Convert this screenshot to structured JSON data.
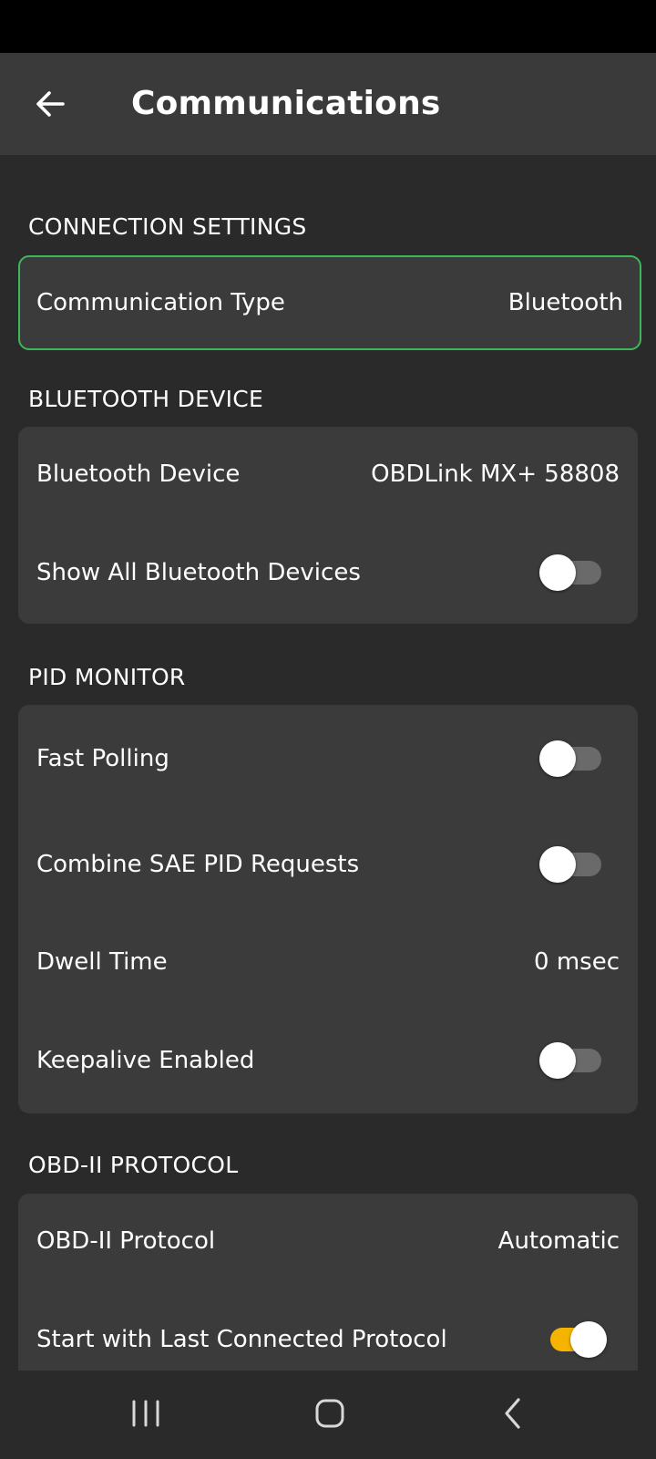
{
  "app_bar": {
    "title": "Communications",
    "back_icon": "arrow-left-icon"
  },
  "sections": {
    "connection": {
      "header": "CONNECTION SETTINGS",
      "communication_type": {
        "label": "Communication Type",
        "value": "Bluetooth"
      }
    },
    "bluetooth": {
      "header": "BLUETOOTH DEVICE",
      "device": {
        "label": "Bluetooth Device",
        "value": "OBDLink MX+ 58808"
      },
      "show_all": {
        "label": "Show All Bluetooth Devices",
        "enabled": false
      }
    },
    "pid_monitor": {
      "header": "PID MONITOR",
      "fast_polling": {
        "label": "Fast Polling",
        "enabled": false
      },
      "combine_sae": {
        "label": "Combine SAE PID Requests",
        "enabled": false
      },
      "dwell_time": {
        "label": "Dwell Time",
        "value": "0 msec"
      },
      "keepalive": {
        "label": "Keepalive Enabled",
        "enabled": false
      }
    },
    "obd2": {
      "header": "OBD-II PROTOCOL",
      "protocol": {
        "label": "OBD-II Protocol",
        "value": "Automatic"
      },
      "start_last": {
        "label": "Start with Last Connected Protocol",
        "enabled": true
      }
    }
  },
  "nav_bar": {
    "recents_icon": "recents-icon",
    "home_icon": "home-icon",
    "back_icon": "chevron-left-icon"
  },
  "colors": {
    "background": "#2a2a2a",
    "card": "#3b3b3b",
    "app_bar": "#3a3a3a",
    "focus_border": "#3fb65a",
    "toggle_on": "#f4b400",
    "toggle_off_track": "#6a6a6a"
  }
}
